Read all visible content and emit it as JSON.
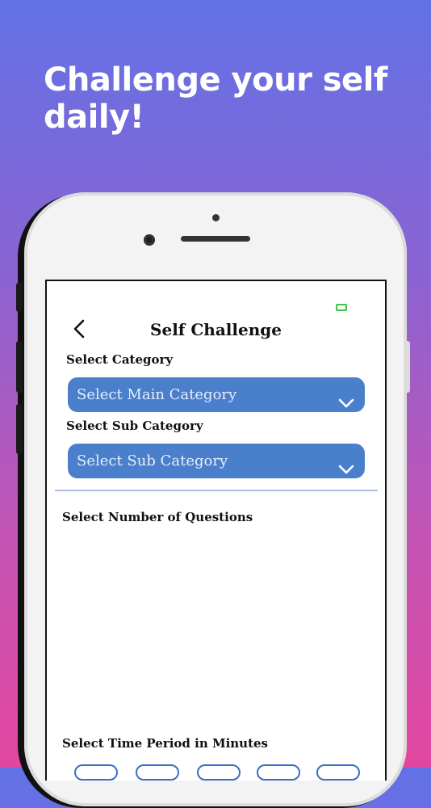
{
  "headline": "Challenge your self daily!",
  "screen": {
    "title": "Self Challenge",
    "category_label": "Select Category",
    "main_category_placeholder": "Select Main Category",
    "sub_category_label": "Select Sub Category",
    "sub_category_placeholder": "Select Sub Category",
    "questions_label": "Select Number of Questions",
    "time_label": "Select Time Period in Minutes"
  },
  "colors": {
    "dropdown": "#4a7fcc",
    "battery": "#3cc24a"
  },
  "icons": [
    "back-chevron-icon",
    "chevron-down-icon",
    "battery-icon"
  ]
}
